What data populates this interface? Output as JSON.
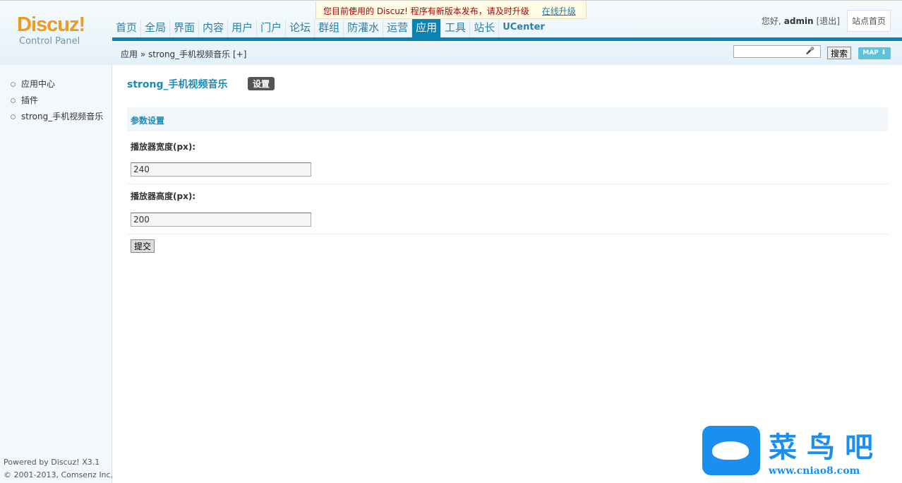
{
  "logo": {
    "brand": "Discuz!",
    "sub": "Control Panel"
  },
  "nav": [
    "首页",
    "全局",
    "界面",
    "内容",
    "用户",
    "门户",
    "论坛",
    "群组",
    "防灌水",
    "运营",
    "应用",
    "工具",
    "站长",
    "UCenter"
  ],
  "nav_active": "应用",
  "notice": {
    "text": "您目前使用的 Discuz! 程序有新版本发布，请及时升级",
    "link": "在线升级"
  },
  "user": {
    "greeting": "您好,",
    "name": "admin",
    "logout": "[退出]",
    "home": "站点首页"
  },
  "breadcrumb": "应用 » strong_手机视频音乐 [+]",
  "search": {
    "value": "",
    "button": "搜索",
    "map": "MAP"
  },
  "sidebar": [
    "应用中心",
    "插件",
    "strong_手机视频音乐"
  ],
  "footer": {
    "line1": "Powered by Discuz! X3.1",
    "line2": "© 2001-2013, Comsenz Inc."
  },
  "main": {
    "title": "strong_手机视频音乐",
    "tag": "设置",
    "section": "参数设置",
    "fields": [
      {
        "label": "播放器宽度(px):",
        "value": "240"
      },
      {
        "label": "播放器高度(px):",
        "value": "200"
      }
    ],
    "submit": "提交"
  },
  "watermark": {
    "name": "菜鸟吧",
    "url": "www.cniao8.com"
  }
}
